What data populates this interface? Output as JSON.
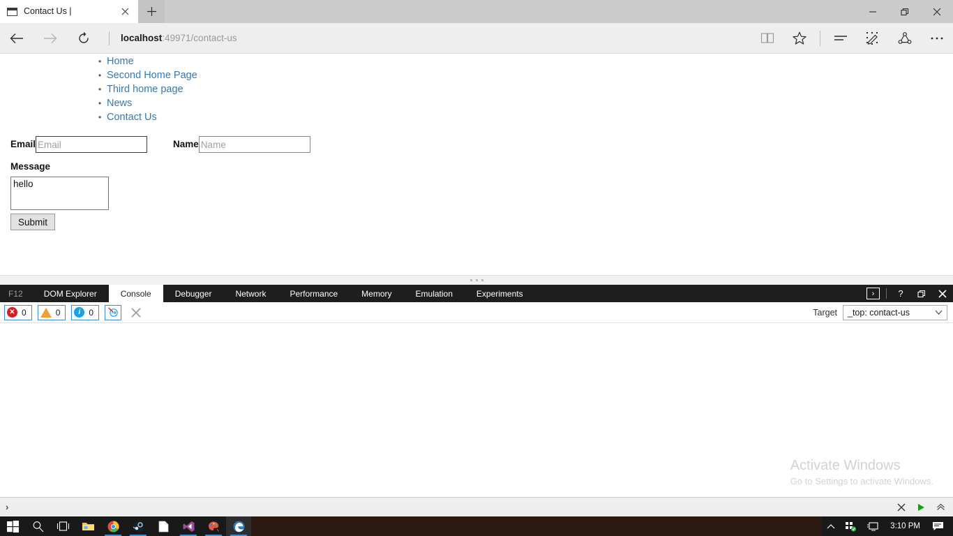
{
  "browser": {
    "tab": {
      "title": "Contact Us |",
      "favicon_icon": "page-icon",
      "close_icon": "close-icon"
    },
    "new_tab_icon": "plus-icon",
    "window_controls": {
      "minimize_icon": "minimize-icon",
      "restore_icon": "restore-icon",
      "close_icon": "close-icon"
    },
    "nav": {
      "back_icon": "arrow-left-icon",
      "forward_icon": "arrow-right-icon",
      "refresh_icon": "refresh-icon",
      "url_host": "localhost",
      "url_path": ":49971/contact-us",
      "icons": [
        {
          "name": "reading-view-icon"
        },
        {
          "name": "favorites-star-icon"
        },
        {
          "name": "hub-icon"
        },
        {
          "name": "web-note-icon"
        },
        {
          "name": "share-icon"
        },
        {
          "name": "more-icon"
        }
      ]
    }
  },
  "page": {
    "nav_links": [
      {
        "label": "Home"
      },
      {
        "label": "Second Home Page"
      },
      {
        "label": "Third home page"
      },
      {
        "label": "News"
      },
      {
        "label": "Contact Us"
      }
    ],
    "form": {
      "email_label": "Email",
      "email_placeholder": "Email",
      "email_value": "",
      "name_label": "Name",
      "name_placeholder": "Name",
      "name_value": "",
      "message_label": "Message",
      "message_value": "hello",
      "submit_label": "Submit"
    },
    "link_color": "#337ab7"
  },
  "devtools": {
    "f12_label": "F12",
    "tabs": [
      {
        "label": "DOM Explorer",
        "active": false
      },
      {
        "label": "Console",
        "active": true
      },
      {
        "label": "Debugger",
        "active": false
      },
      {
        "label": "Network",
        "active": false
      },
      {
        "label": "Performance",
        "active": false
      },
      {
        "label": "Memory",
        "active": false
      },
      {
        "label": "Emulation",
        "active": false
      },
      {
        "label": "Experiments",
        "active": false
      }
    ],
    "window_buttons": {
      "console_toggle_icon": "console-toggle-icon",
      "help_label": "?",
      "restore_icon": "restore-icon",
      "close_icon": "close-icon"
    },
    "console": {
      "error_count": "0",
      "warning_count": "0",
      "info_count": "0",
      "error_icon": "error-circle-icon",
      "warning_icon": "warning-triangle-icon",
      "info_icon": "info-circle-icon",
      "info_glyph": "i",
      "error_glyph": "✕",
      "clear_on_navigate_icon": "clear-on-navigate-icon",
      "clear_icon": "clear-x-icon",
      "target_label": "Target",
      "target_value": "_top: contact-us",
      "target_chevron_icon": "chevron-down-icon",
      "prompt_caret": "›",
      "input_value": "",
      "input_clear_icon": "clear-x-icon",
      "input_run_icon": "run-triangle-icon",
      "input_expand_icon": "chevron-up-icon"
    }
  },
  "watermark": {
    "title": "Activate Windows",
    "subtitle": "Go to Settings to activate Windows."
  },
  "taskbar": {
    "items": [
      {
        "name": "start-button",
        "icon": "windows-logo-icon"
      },
      {
        "name": "search-button",
        "icon": "search-icon"
      },
      {
        "name": "task-view-button",
        "icon": "task-view-icon"
      },
      {
        "name": "file-explorer-button",
        "icon": "folder-icon"
      },
      {
        "name": "chrome-button",
        "icon": "chrome-icon"
      },
      {
        "name": "steam-button",
        "icon": "steam-icon"
      },
      {
        "name": "document-button",
        "icon": "document-icon"
      },
      {
        "name": "visual-studio-button",
        "icon": "visual-studio-icon"
      },
      {
        "name": "paint-button",
        "icon": "paint-icon"
      },
      {
        "name": "edge-button",
        "icon": "edge-icon"
      }
    ],
    "tray": {
      "overflow_icon": "chevron-up-icon",
      "network_icon": "network-icon",
      "display_icon": "display-icon",
      "clock": "3:10 PM",
      "action_center_icon": "action-center-icon"
    }
  }
}
